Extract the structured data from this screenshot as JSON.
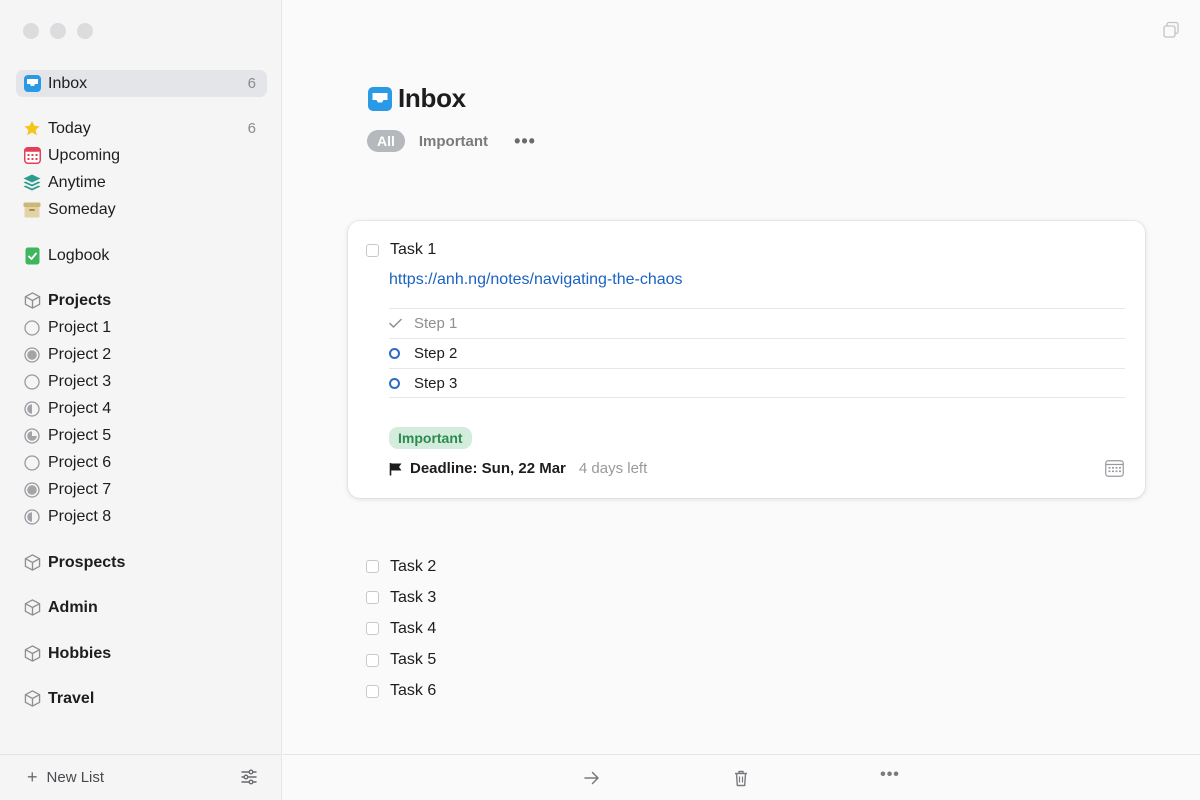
{
  "sidebar": {
    "inbox": {
      "label": "Inbox",
      "count": "6"
    },
    "today": {
      "label": "Today",
      "count": "6"
    },
    "upcoming": {
      "label": "Upcoming"
    },
    "anytime": {
      "label": "Anytime"
    },
    "someday": {
      "label": "Someday"
    },
    "logbook": {
      "label": "Logbook"
    },
    "projects_header": "Projects",
    "projects": [
      "Project 1",
      "Project 2",
      "Project 3",
      "Project 4",
      "Project 5",
      "Project 6",
      "Project 7",
      "Project 8"
    ],
    "areas": [
      "Prospects",
      "Admin",
      "Hobbies",
      "Travel"
    ],
    "new_list": "New List"
  },
  "main": {
    "title": "Inbox",
    "filters": {
      "all": "All",
      "important": "Important",
      "more": "•••"
    },
    "expanded_task": {
      "title": "Task 1",
      "link": "https://anh.ng/notes/navigating-the-chaos",
      "steps": [
        {
          "label": "Step 1",
          "done": true
        },
        {
          "label": "Step 2",
          "done": false
        },
        {
          "label": "Step 3",
          "done": false
        }
      ],
      "tag": "Important",
      "deadline": "Deadline: Sun, 22 Mar",
      "days_left": "4 days left"
    },
    "tasks": [
      "Task 2",
      "Task 3",
      "Task 4",
      "Task 5",
      "Task 6"
    ]
  },
  "toolbar": {
    "more": "•••"
  },
  "colors": {
    "inbox": "#2a9ae6",
    "today": "#f5c518",
    "upcoming": "#e23f5a",
    "anytime": "#2f9b8b",
    "someday": "#cdb67a",
    "logbook": "#3fb55d",
    "link": "#1a62c4",
    "tag_bg": "#d3ecdc",
    "tag_text": "#2c8a4f"
  }
}
